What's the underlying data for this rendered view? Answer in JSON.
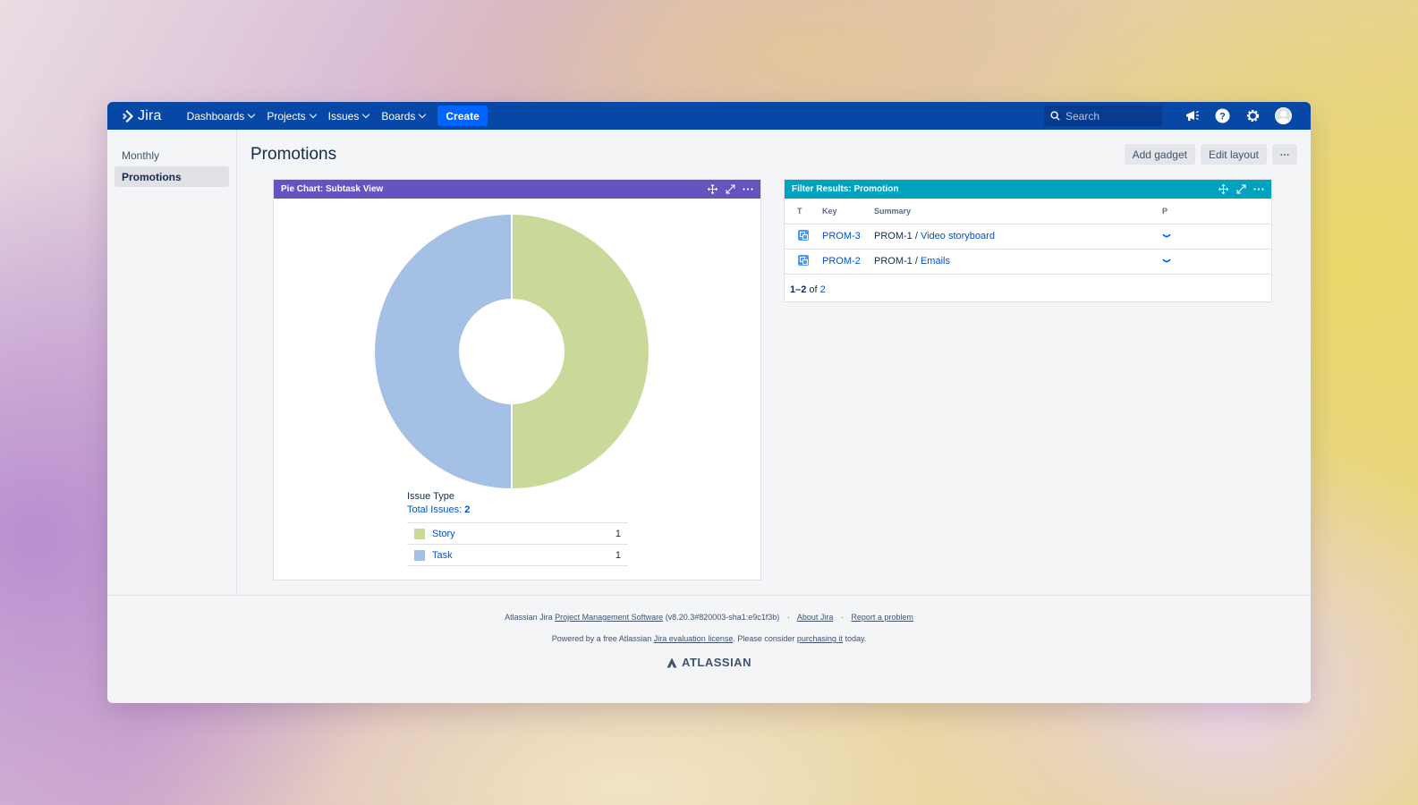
{
  "nav": {
    "product": "Jira",
    "items": [
      {
        "label": "Dashboards"
      },
      {
        "label": "Projects"
      },
      {
        "label": "Issues"
      },
      {
        "label": "Boards"
      }
    ],
    "create_label": "Create",
    "search_placeholder": "Search"
  },
  "sidebar": {
    "items": [
      {
        "label": "Monthly"
      },
      {
        "label": "Promotions"
      }
    ]
  },
  "page": {
    "title": "Promotions",
    "add_gadget": "Add gadget",
    "edit_layout": "Edit layout"
  },
  "pie_gadget": {
    "title": "Pie Chart: Subtask View",
    "legend_title": "Issue Type",
    "total_label": "Total Issues:",
    "total_value": "2",
    "legend": [
      {
        "label": "Story",
        "count": "1",
        "color": "#c9d99a"
      },
      {
        "label": "Task",
        "count": "1",
        "color": "#a4c0e4"
      }
    ]
  },
  "chart_data": {
    "type": "pie",
    "categories": [
      "Story",
      "Task"
    ],
    "values": [
      1,
      1
    ],
    "colors": [
      "#c9d99a",
      "#a4c0e4"
    ],
    "title": "Issue Type"
  },
  "filter_gadget": {
    "title": "Filter Results: Promotion",
    "columns": [
      "T",
      "Key",
      "Summary",
      "P"
    ],
    "rows": [
      {
        "key": "PROM-3",
        "parent": "PROM-1 /",
        "summary": "Video storyboard"
      },
      {
        "key": "PROM-2",
        "parent": "PROM-1 /",
        "summary": "Emails"
      }
    ],
    "pager_range": "1–2",
    "pager_of": "of",
    "pager_total": "2"
  },
  "footer": {
    "line1_prefix": "Atlassian Jira",
    "line1_link": "Project Management Software",
    "line1_version": "(v8.20.3#820003-sha1:e9c1f3b)",
    "about": "About Jira",
    "report": "Report a problem",
    "line2_prefix": "Powered by a free Atlassian",
    "line2_link": "Jira evaluation license",
    "line2_mid": ". Please consider",
    "line2_link2": "purchasing it",
    "line2_suffix": "today.",
    "brand": "ATLASSIAN"
  }
}
